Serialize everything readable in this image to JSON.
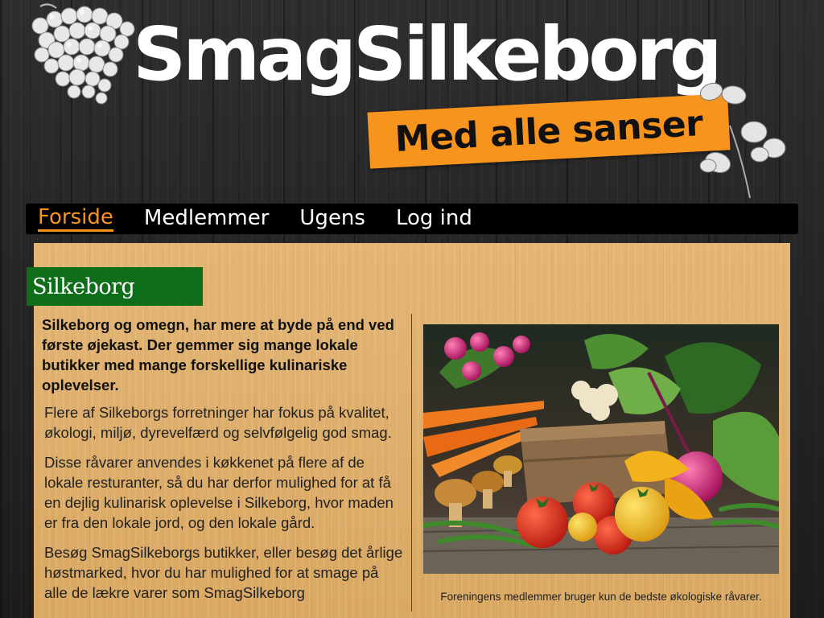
{
  "header": {
    "logo_text": "SmagSilkeborg",
    "slogan": "Med alle sanser"
  },
  "nav": {
    "items": [
      {
        "label": "Forside",
        "active": true
      },
      {
        "label": "Medlemmer",
        "active": false
      },
      {
        "label": "Ugens",
        "active": false
      },
      {
        "label": "Log ind",
        "active": false
      }
    ]
  },
  "main": {
    "section_title": "Silkeborg",
    "lead": "Silkeborg og omegn, har mere at byde på end ved første øjekast. Der gemmer sig mange lokale butikker med mange forskellige kulinariske oplevelser.",
    "paragraphs": [
      "Flere af Silkeborgs forretninger har fokus på kvalitet, økologi, miljø, dyrevelfærd og selvfølgelig god smag.",
      "Disse råvarer anvendes i køkkenet på flere af de lokale resturanter, så du har derfor mulighed for at få en dejlig kulinarisk oplevelse i Silkeborg, hvor maden er fra den lokale jord, og den lokale gård.",
      "Besøg SmagSilkeborgs butikker, eller besøg det årlige høstmarked, hvor du har mulighed for at smage på alle de lækre varer som SmagSilkeborg"
    ],
    "image_caption": "Foreningens medlemmer bruger kun de bedste økologiske råvarer."
  },
  "colors": {
    "accent": "#f7941e",
    "section_green": "#0f6e1a",
    "panel": "#dfae69",
    "nav_bg": "#000000"
  },
  "icons": {
    "grapes": "grapes-decoration-icon",
    "leaves": "leaves-decoration-icon"
  }
}
